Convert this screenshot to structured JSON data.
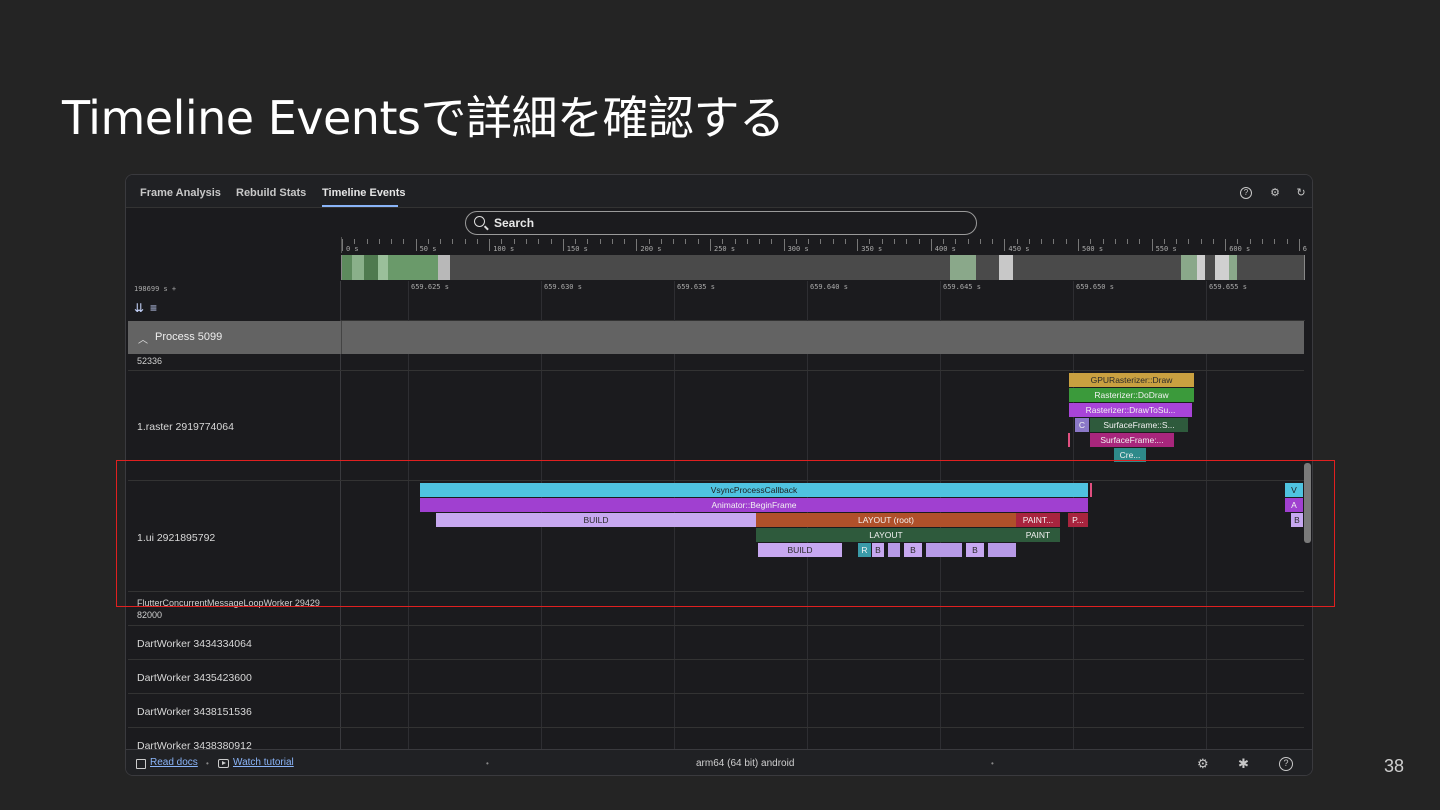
{
  "slide": {
    "title": "Timeline Eventsで詳細を確認する",
    "page_number": "38"
  },
  "tabs": [
    {
      "label": "Frame Analysis"
    },
    {
      "label": "Rebuild Stats"
    },
    {
      "label": "Timeline Events",
      "active": true
    }
  ],
  "top_icons": [
    "help-icon",
    "gear-icon",
    "refresh-icon"
  ],
  "search": {
    "placeholder": "Search"
  },
  "overview_ticks": [
    "0 s",
    "50 s",
    "100 s",
    "150 s",
    "200 s",
    "250 s",
    "300 s",
    "350 s",
    "400 s",
    "450 s",
    "500 s",
    "550 s",
    "600 s",
    "6"
  ],
  "time_origin": "198699 s +",
  "time_ruler": [
    "659.625 s",
    "659.630 s",
    "659.635 s",
    "659.640 s",
    "659.645 s",
    "659.650 s",
    "659.655 s"
  ],
  "process": {
    "label": "Process 5099"
  },
  "threads": {
    "t0": "52336",
    "raster": "1.raster 2919774064",
    "ui": "1.ui 2921895792",
    "worker_line1": "FlutterConcurrentMessageLoopWorker 29429",
    "worker_line2": "82000",
    "dart1": "DartWorker 3434334064",
    "dart2": "DartWorker 3435423600",
    "dart3": "DartWorker 3438151536",
    "dart4": "DartWorker 3438380912"
  },
  "raster_events": {
    "gpu": "GPURasterizer::Draw",
    "dodraw": "Rasterizer::DoDraw",
    "drawto": "Rasterizer::DrawToSu...",
    "c": "C",
    "surface1": "SurfaceFrame::S...",
    "surface2": "SurfaceFrame:...",
    "cre": "Cre..."
  },
  "ui_events": {
    "vsync": "VsyncProcessCallback",
    "animator": "Animator::BeginFrame",
    "build": "BUILD",
    "layout_root": "LAYOUT (root)",
    "paint1": "PAINT...",
    "p": "P...",
    "layout": "LAYOUT",
    "paint2": "PAINT",
    "build2": "BUILD",
    "r": "R",
    "b1": "B",
    "b2": "B",
    "b3": "B",
    "v": "V",
    "a": "A",
    "b4": "B"
  },
  "statusbar": {
    "read_docs": "Read docs",
    "watch_tutorial": "Watch tutorial",
    "device": "arm64 (64 bit) android"
  },
  "colors": {
    "vsync": "#4fc3e0",
    "animator": "#a040d0",
    "build": "#c7a8f0",
    "layout_root": "#b0502a",
    "paint": "#a8243e",
    "layout": "#2e5a3c",
    "raster_gpu": "#c9a040",
    "raster_dodraw": "#3b9a3b",
    "raster_drawto": "#a844d8",
    "highlight": "#e02020"
  }
}
